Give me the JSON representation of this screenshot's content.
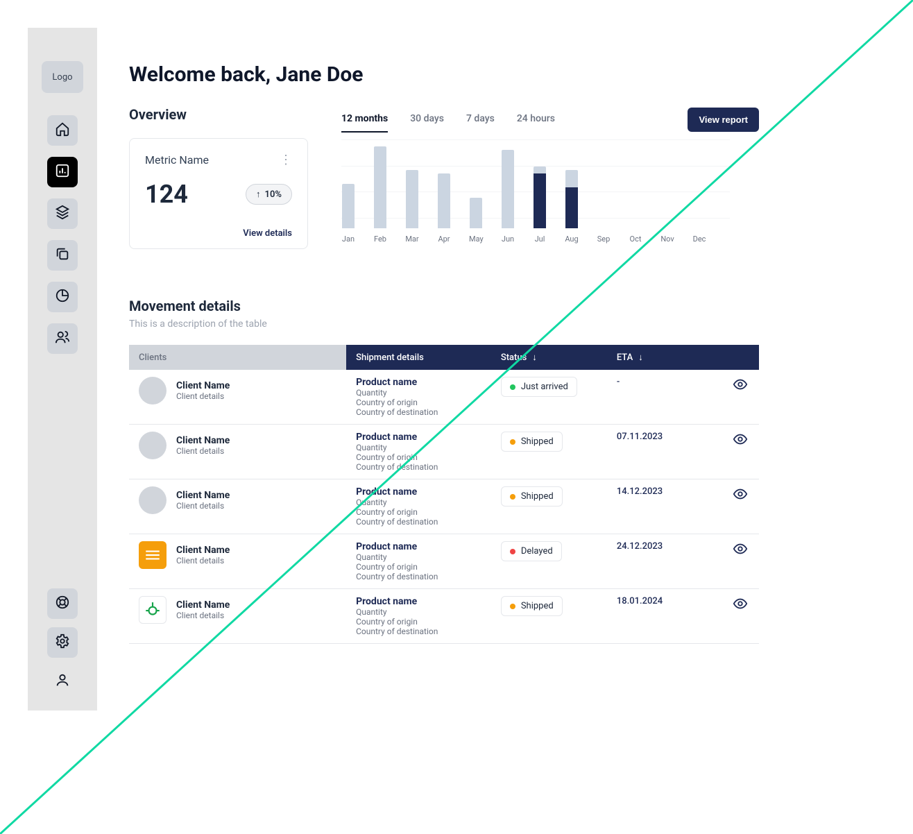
{
  "brand": {
    "logo_text": "Logo"
  },
  "nav": {
    "items": [
      {
        "name": "home",
        "active": false
      },
      {
        "name": "dashboard",
        "active": true
      },
      {
        "name": "layers",
        "active": false
      },
      {
        "name": "copy",
        "active": false
      },
      {
        "name": "pie",
        "active": false
      },
      {
        "name": "users",
        "active": false
      }
    ],
    "bottom": [
      {
        "name": "help"
      },
      {
        "name": "settings"
      },
      {
        "name": "profile"
      }
    ]
  },
  "header": {
    "welcome": "Welcome back, Jane Doe"
  },
  "overview": {
    "title": "Overview",
    "metric_name": "Metric Name",
    "metric_value": "124",
    "delta": "10%",
    "view_details": "View details",
    "view_report": "View report",
    "tabs": [
      "12 months",
      "30 days",
      "7 days",
      "24 hours"
    ],
    "active_tab": 0
  },
  "chart_data": {
    "type": "bar",
    "categories": [
      "Jan",
      "Feb",
      "Mar",
      "Apr",
      "May",
      "Jun",
      "Jul",
      "Aug",
      "Sep",
      "Oct",
      "Nov",
      "Dec"
    ],
    "series": [
      {
        "name": "total",
        "color": "#cbd5e1",
        "values": [
          65,
          120,
          85,
          80,
          45,
          115,
          90,
          85,
          0,
          0,
          0,
          0
        ]
      },
      {
        "name": "highlight",
        "color": "#1e2a55",
        "values": [
          0,
          0,
          0,
          0,
          0,
          0,
          80,
          60,
          0,
          0,
          0,
          0
        ]
      }
    ],
    "ylim": [
      0,
      130
    ],
    "title": "",
    "xlabel": "",
    "ylabel": ""
  },
  "movement": {
    "title": "Movement details",
    "desc": "This is a description of the table",
    "columns": {
      "clients": "Clients",
      "shipment": "Shipment details",
      "status": "Status",
      "eta": "ETA"
    },
    "rows": [
      {
        "client_name": "Client Name",
        "client_sub": "Client details",
        "avatar": "circle",
        "product_name": "Product name",
        "qty": "Quantity",
        "origin": "Country of origin",
        "dest": "Country of destination",
        "status_label": "Just arrived",
        "status_color": "#22c55e",
        "eta": "-"
      },
      {
        "client_name": "Client Name",
        "client_sub": "Client details",
        "avatar": "circle",
        "product_name": "Product name",
        "qty": "Quantity",
        "origin": "Country of origin",
        "dest": "Country of destination",
        "status_label": "Shipped",
        "status_color": "#f59e0b",
        "eta": "07.11.2023"
      },
      {
        "client_name": "Client Name",
        "client_sub": "Client details",
        "avatar": "circle",
        "product_name": "Product name",
        "qty": "Quantity",
        "origin": "Country of origin",
        "dest": "Country of destination",
        "status_label": "Shipped",
        "status_color": "#f59e0b",
        "eta": "14.12.2023"
      },
      {
        "client_name": "Client Name",
        "client_sub": "Client details",
        "avatar": "square-orange",
        "product_name": "Product name",
        "qty": "Quantity",
        "origin": "Country of origin",
        "dest": "Country of destination",
        "status_label": "Delayed",
        "status_color": "#ef4444",
        "eta": "24.12.2023"
      },
      {
        "client_name": "Client Name",
        "client_sub": "Client details",
        "avatar": "square-green",
        "product_name": "Product name",
        "qty": "Quantity",
        "origin": "Country of origin",
        "dest": "Country of destination",
        "status_label": "Shipped",
        "status_color": "#f59e0b",
        "eta": "18.01.2024"
      }
    ]
  }
}
